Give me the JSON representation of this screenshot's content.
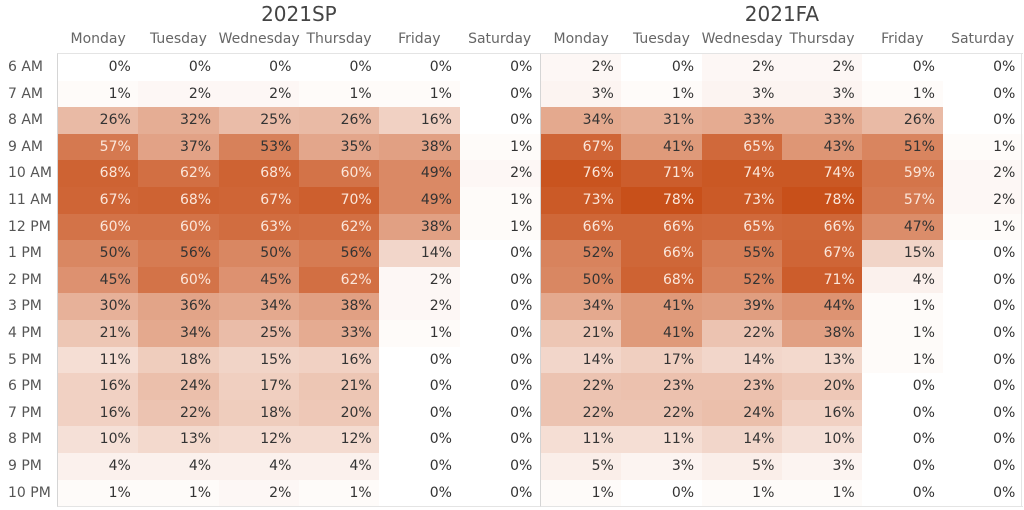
{
  "chart_data": {
    "type": "heatmap",
    "title": "",
    "value_format": "percent",
    "color_scale": {
      "low": "#ffffff",
      "high": "#c8501a",
      "min": 0,
      "max": 78
    },
    "row_labels": [
      "6 AM",
      "7 AM",
      "8 AM",
      "9 AM",
      "10 AM",
      "11 AM",
      "12 PM",
      "1 PM",
      "2 PM",
      "3 PM",
      "4 PM",
      "5 PM",
      "6 PM",
      "7 PM",
      "8 PM",
      "9 PM",
      "10 PM"
    ],
    "column_labels": [
      "Monday",
      "Tuesday",
      "Wednesday",
      "Thursday",
      "Friday",
      "Saturday"
    ],
    "panels": [
      {
        "title": "2021SP",
        "values": [
          [
            0,
            0,
            0,
            0,
            0,
            0
          ],
          [
            1,
            2,
            2,
            1,
            1,
            0
          ],
          [
            26,
            32,
            25,
            26,
            16,
            0
          ],
          [
            57,
            37,
            53,
            35,
            38,
            1
          ],
          [
            68,
            62,
            68,
            60,
            49,
            2
          ],
          [
            67,
            68,
            67,
            70,
            49,
            1
          ],
          [
            60,
            60,
            63,
            62,
            38,
            1
          ],
          [
            50,
            56,
            50,
            56,
            14,
            0
          ],
          [
            45,
            60,
            45,
            62,
            2,
            0
          ],
          [
            30,
            36,
            34,
            38,
            2,
            0
          ],
          [
            21,
            34,
            25,
            33,
            1,
            0
          ],
          [
            11,
            18,
            15,
            16,
            0,
            0
          ],
          [
            16,
            24,
            17,
            21,
            0,
            0
          ],
          [
            16,
            22,
            18,
            20,
            0,
            0
          ],
          [
            10,
            13,
            12,
            12,
            0,
            0
          ],
          [
            4,
            4,
            4,
            4,
            0,
            0
          ],
          [
            1,
            1,
            2,
            1,
            0,
            0
          ]
        ]
      },
      {
        "title": "2021FA",
        "values": [
          [
            2,
            0,
            2,
            2,
            0,
            0
          ],
          [
            3,
            1,
            3,
            3,
            1,
            0
          ],
          [
            34,
            31,
            33,
            33,
            26,
            0
          ],
          [
            67,
            41,
            65,
            43,
            51,
            1
          ],
          [
            76,
            71,
            74,
            74,
            59,
            2
          ],
          [
            73,
            78,
            73,
            78,
            57,
            2
          ],
          [
            66,
            66,
            65,
            66,
            47,
            1
          ],
          [
            52,
            66,
            55,
            67,
            15,
            0
          ],
          [
            50,
            68,
            52,
            71,
            4,
            0
          ],
          [
            34,
            41,
            39,
            44,
            1,
            0
          ],
          [
            21,
            41,
            22,
            38,
            1,
            0
          ],
          [
            14,
            17,
            14,
            13,
            1,
            0
          ],
          [
            22,
            23,
            23,
            20,
            0,
            0
          ],
          [
            22,
            22,
            24,
            16,
            0,
            0
          ],
          [
            11,
            11,
            14,
            10,
            0,
            0
          ],
          [
            5,
            3,
            5,
            3,
            0,
            0
          ],
          [
            1,
            0,
            1,
            1,
            0,
            0
          ]
        ]
      }
    ]
  }
}
